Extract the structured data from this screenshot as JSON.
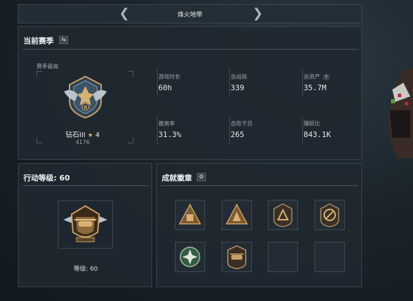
{
  "topbar": {
    "title": "烽火地带",
    "prev_icon": "chevron-left-icon",
    "next_icon": "chevron-right-icon"
  },
  "season": {
    "title": "当前赛季",
    "subtitle": "赛季最高",
    "rank_name": "钻石III",
    "rank_stars": "4",
    "rank_points": "4176",
    "stats": [
      {
        "label": "游戏时长",
        "value": "60h"
      },
      {
        "label": "总战局",
        "value": "339"
      },
      {
        "label": "总资产",
        "value": "35.7M"
      },
      {
        "label": "撤离率",
        "value": "31.3%"
      },
      {
        "label": "击败干员",
        "value": "265"
      },
      {
        "label": "赚损比",
        "value": "843.1K"
      }
    ]
  },
  "action_level": {
    "title": "行动等级: 60",
    "level_label": "等级: 60"
  },
  "achievements": {
    "title": "成就徽章"
  },
  "colors": {
    "accent_gold": "#c9a063",
    "panel": "#1f2830"
  }
}
